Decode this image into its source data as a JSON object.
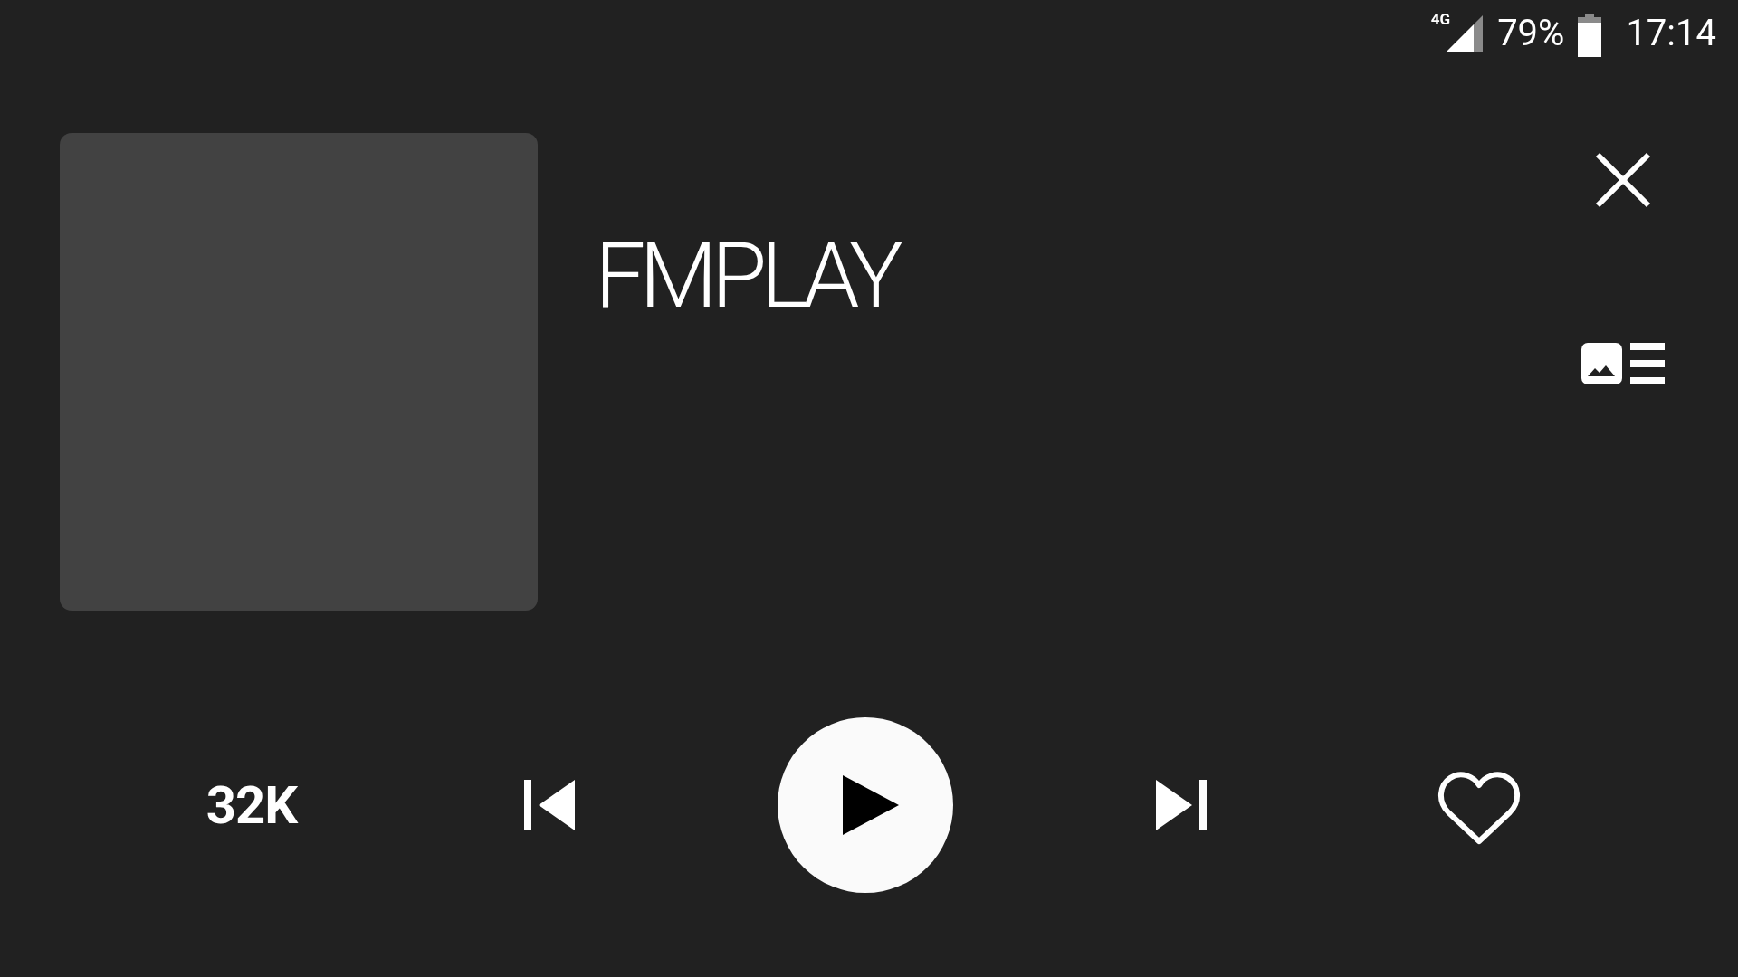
{
  "status_bar": {
    "network": "4G",
    "battery": "79%",
    "time": "17:14"
  },
  "now_playing": {
    "title": "FMPLAY"
  },
  "controls": {
    "bitrate": "32K",
    "playing": false,
    "favorite": false
  }
}
